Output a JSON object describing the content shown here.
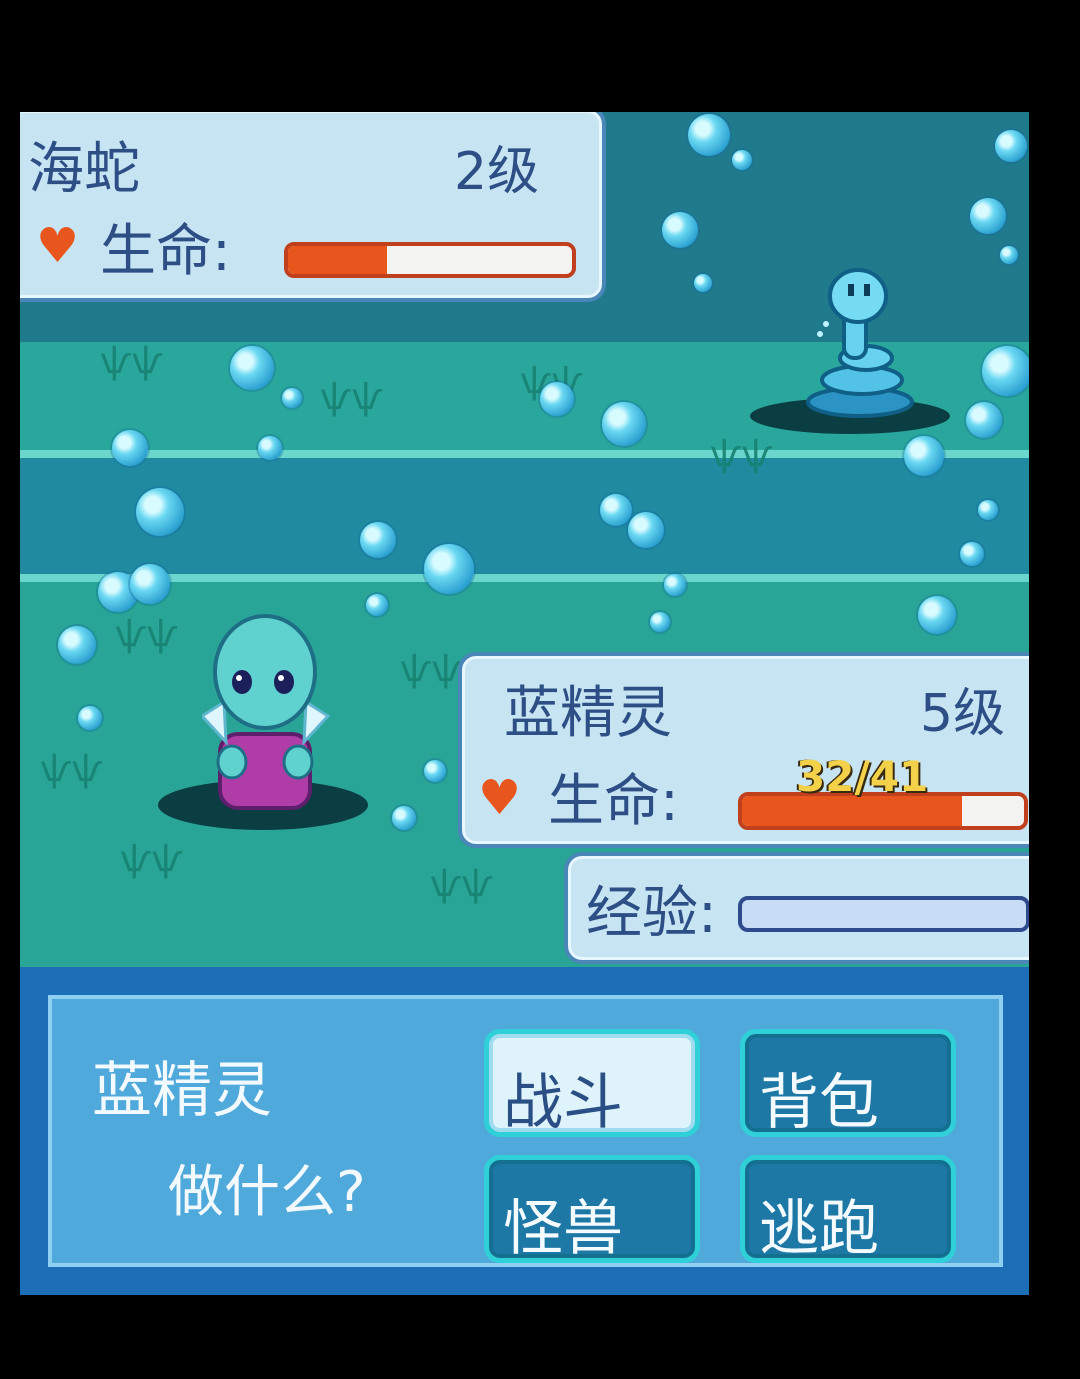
{
  "enemy": {
    "name": "海蛇",
    "level": "2级",
    "hp_label": "生命:",
    "hp_fraction": 0.35
  },
  "player": {
    "name": "蓝精灵",
    "level": "5级",
    "hp_label": "生命:",
    "hp_text": "32/41",
    "hp_fraction": 0.78,
    "exp_label": "经验:",
    "exp_fraction": 0.0
  },
  "menu": {
    "prompt_name": "蓝精灵",
    "prompt_question": "做什么?",
    "commands": [
      "战斗",
      "背包",
      "怪兽",
      "逃跑"
    ],
    "selected_index": 0
  },
  "colors": {
    "hp_fill": "#e8561e",
    "panel_bg": "#c7e4f3",
    "menu_bg": "#1c6fb6"
  }
}
